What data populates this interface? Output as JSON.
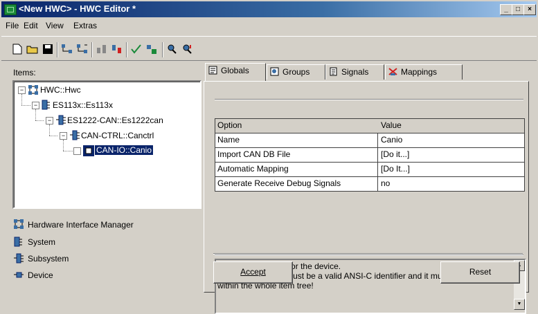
{
  "window": {
    "title": "<New HWC> - HWC Editor  *"
  },
  "menu": [
    "File",
    "Edit",
    "View",
    "Extras"
  ],
  "toolbar": [
    "new-icon",
    "open-icon",
    "save-icon",
    "add-node-icon",
    "add-child-icon",
    "move-up-icon",
    "move-down-icon",
    "check-icon",
    "generate-icon",
    "search-icon",
    "search-next-icon"
  ],
  "items_label": "Items:",
  "tree": [
    {
      "label": "HWC::Hwc",
      "level": 0
    },
    {
      "label": "ES113x::Es113x",
      "level": 1
    },
    {
      "label": "ES1222-CAN::Es1222can",
      "level": 2
    },
    {
      "label": "CAN-CTRL::Canctrl",
      "level": 3
    },
    {
      "label": "CAN-IO::Canio",
      "level": 4,
      "selected": true
    }
  ],
  "legend": [
    {
      "label": "Hardware Interface Manager",
      "icon": "manager-icon"
    },
    {
      "label": "System",
      "icon": "system-icon"
    },
    {
      "label": "Subsystem",
      "icon": "subsystem-icon"
    },
    {
      "label": "Device",
      "icon": "device-icon"
    }
  ],
  "tabs": [
    {
      "label": "Globals",
      "active": true
    },
    {
      "label": "Groups"
    },
    {
      "label": "Signals"
    },
    {
      "label": "Mappings"
    }
  ],
  "grid": {
    "header": [
      "Option",
      "Value"
    ],
    "rows": [
      [
        "Name",
        "Canio"
      ],
      [
        "Import CAN DB File",
        "[Do it...]"
      ],
      [
        "Automatic Mapping",
        "[Do It...]"
      ],
      [
        "Generate Receive Debug Signals",
        "no"
      ]
    ]
  },
  "note": "Please set a name for the device.\nNOTE: This name must be a valid ANSI-C identifier and it must be unique within the whole item tree!",
  "buttons": {
    "accept": "Accept",
    "reset": "Reset"
  }
}
